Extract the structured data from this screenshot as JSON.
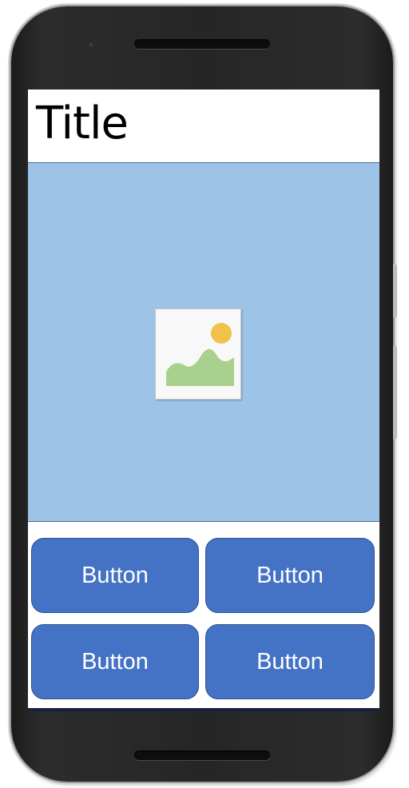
{
  "screen": {
    "title": "Title",
    "image_icon": "image-placeholder-icon",
    "buttons": [
      {
        "label": "Button"
      },
      {
        "label": "Button"
      },
      {
        "label": "Button"
      },
      {
        "label": "Button"
      }
    ]
  },
  "colors": {
    "image_area_bg": "#9dc3e6",
    "button_bg": "#4472c4",
    "button_border": "#2f528f",
    "button_text": "#ffffff",
    "divider": "#41719c",
    "device_body": "#262626"
  }
}
